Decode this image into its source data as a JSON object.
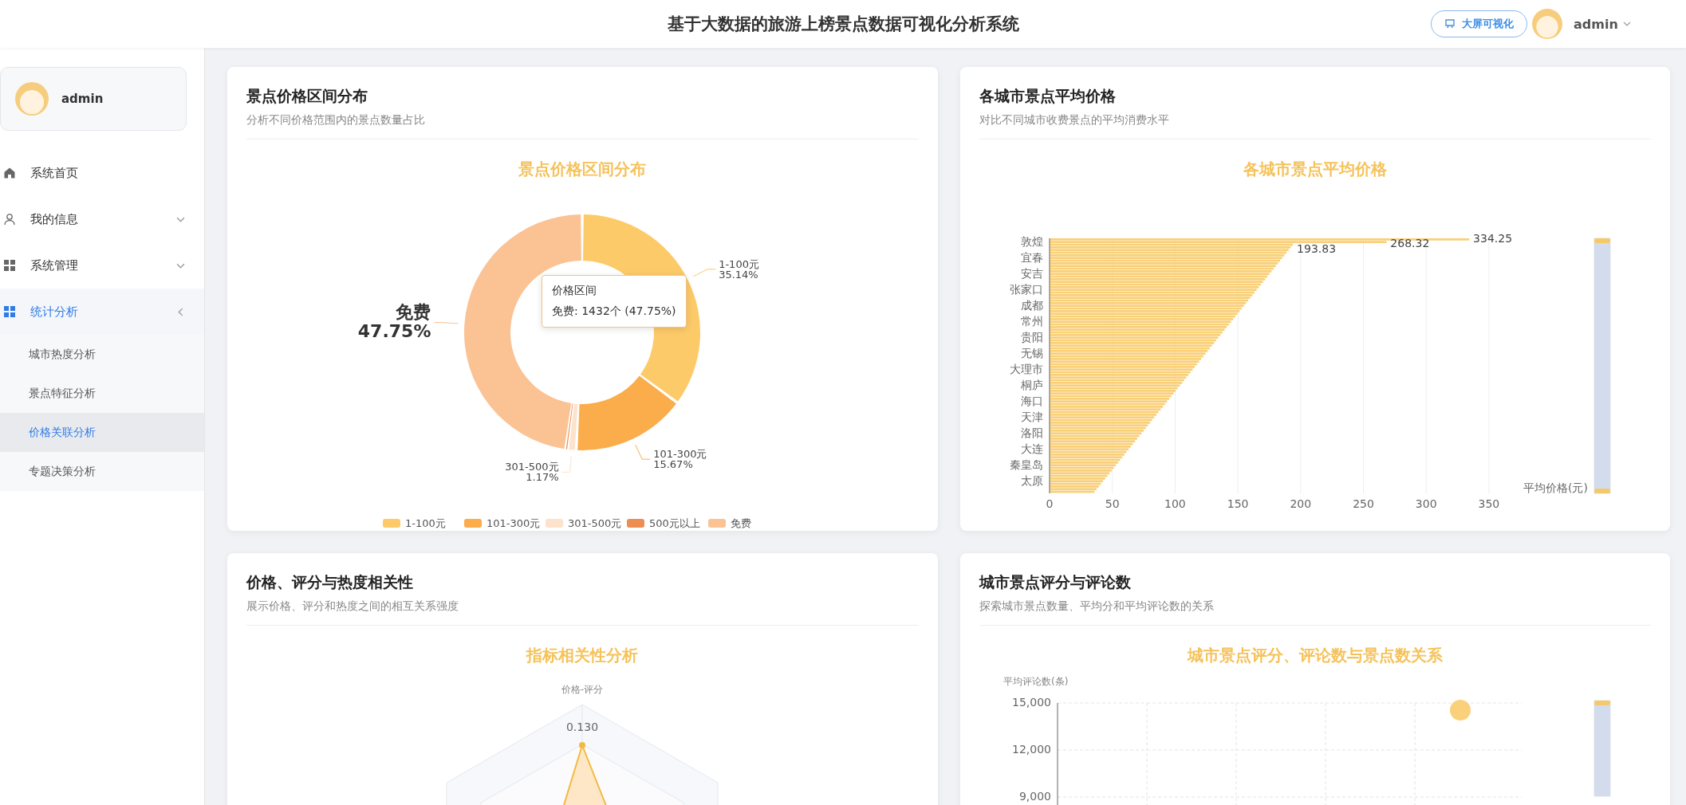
{
  "header": {
    "title": "基于大数据的旅游上榜景点数据可视化分析系统",
    "bigscreen_button": "大屏可视化",
    "user": "admin"
  },
  "sidebar": {
    "user": "admin",
    "items": [
      {
        "label": "系统首页",
        "kind": "home",
        "selected": false
      },
      {
        "label": "我的信息",
        "kind": "user",
        "selected": false,
        "expanded": false
      },
      {
        "label": "系统管理",
        "kind": "grid",
        "selected": false,
        "expanded": false
      },
      {
        "label": "统计分析",
        "kind": "grid",
        "selected": true,
        "expanded": true,
        "children": [
          {
            "label": "城市热度分析",
            "selected": false
          },
          {
            "label": "景点特征分析",
            "selected": false
          },
          {
            "label": "价格关联分析",
            "selected": true
          },
          {
            "label": "专题决策分析",
            "selected": false
          }
        ]
      }
    ]
  },
  "panels": [
    {
      "kind": "donut",
      "title": "景点价格区间分布",
      "subtitle": "分析不同价格范围内的景点数量占比",
      "chart_title": "景点价格区间分布",
      "tooltip": {
        "line": "免费: 1432个 (47.75%)"
      },
      "labels": [
        {
          "name": "1-100元",
          "percent": "35.14%",
          "emphasis": false
        },
        {
          "name": "101-300元",
          "percent": "15.67%",
          "emphasis": false
        },
        {
          "name": "301-500元",
          "percent": "1.17%",
          "emphasis": false
        },
        {
          "name": "免费",
          "percent": "47.75%",
          "emphasis": true
        }
      ],
      "chart_data": {
        "type": "donut",
        "legend": true,
        "categories": [
          "1-100元",
          "101-300元",
          "301-500元",
          "500元以上",
          "免费"
        ],
        "series": [
          {
            "name": "价格区间",
            "values": [
              35.14,
              15.67,
              1.17,
              0.27,
              47.75
            ]
          }
        ],
        "colors": [
          "#fdca69",
          "#fbac4b",
          "#fde2cc",
          "#ec8e53",
          "#fbc294"
        ]
      }
    },
    {
      "kind": "bar",
      "title": "各城市景点平均价格",
      "subtitle": "对比不同城市收费景点的平均消费水平",
      "chart_title": "各城市景点平均价格",
      "cities": [
        "敦煌",
        "宜春",
        "安吉",
        "张家口",
        "成都",
        "常州",
        "贵阳",
        "无锡",
        "大理市",
        "桐庐",
        "海口",
        "天津",
        "洛阳",
        "大连",
        "秦皇岛",
        "太原"
      ],
      "top_value_labels": [
        "334.25",
        "268.32",
        "193.83"
      ],
      "x_ticks": [
        "0",
        "50",
        "100",
        "150",
        "200",
        "250",
        "300",
        "350"
      ],
      "x_axis_name": "平均价格(元)",
      "zoom": {
        "level": 1
      }
    },
    {
      "kind": "radar",
      "title": "价格、评分与热度相关性",
      "subtitle": "展示价格、评分和热度之间的相互关系强度",
      "chart_title": "指标相关性分析",
      "axis_label": "价格-评分",
      "value_label": "0.130"
    },
    {
      "kind": "scatter",
      "title": "城市景点评分与评论数",
      "subtitle": "探索城市景点数量、平均分和平均评论数的关系",
      "chart_title": "城市景点评分、评论数与景点数关系",
      "y_axis_name": "平均评论数(条)",
      "y_ticks": [
        "15,000",
        "12,000",
        "9,000"
      ],
      "zoom": {
        "level": 1
      }
    }
  ]
}
